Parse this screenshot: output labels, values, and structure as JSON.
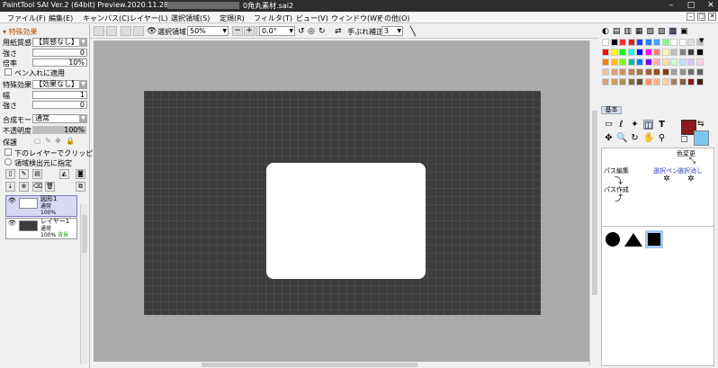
{
  "window": {
    "title": "PaintTool SAI Ver.2 (64bit) Preview.2020.11.28",
    "filename": "0角丸素材.sai2",
    "controls": [
      "–",
      "□",
      "✕"
    ]
  },
  "menu": [
    "ファイル(F)",
    "編集(E)",
    "キャンバス(C)",
    "レイヤー(L)",
    "選択領域(S)",
    "定規(R)",
    "フィルタ(T)",
    "ビュー(V)",
    "ウィンドウ(W)",
    "その他(O)"
  ],
  "toolbar": {
    "selection_label": "選択領域",
    "zoom_value": "50%",
    "zoom_minus": "−",
    "zoom_plus": "+",
    "angle_value": "0.0°",
    "stabilizer_label": "手ぶれ補正",
    "stabilizer_value": "3"
  },
  "left_panel": {
    "section_title": "特殊効果",
    "paper_texture_label": "用紙質感",
    "paper_texture_value": "【質感なし】",
    "strength_label": "強さ",
    "strength_value": "0",
    "scale_label": "倍率",
    "scale_value": "10%",
    "pen_apply_label": "ペン入れに適用",
    "special_effect_label": "特殊効果",
    "special_effect_value": "【効果なし】",
    "width_label": "幅",
    "width_value": "1",
    "strength2_label": "強さ",
    "strength2_value": "0",
    "blend_mode_label": "合成モード",
    "blend_mode_value": "通常",
    "opacity_label": "不透明度",
    "opacity_value": "100%",
    "protect_label": "保護",
    "clip_label": "下のレイヤーでクリッピング",
    "region_label": "領域検出元に指定"
  },
  "layers": [
    {
      "name": "図形1",
      "mode": "通常",
      "opacity": "100%",
      "extra": "",
      "selected": true
    },
    {
      "name": "レイヤー1",
      "mode": "通常",
      "opacity": "100%",
      "extra": "背景",
      "selected": false
    }
  ],
  "right_panel": {
    "tab_basic": "基本",
    "color_change_label": "色変更",
    "path_edit_label": "パス編集",
    "select_pen_label": "選択ペン",
    "select_erase_label": "選択消し",
    "path_create_label": "パス作成",
    "main_color": "#8b1a1a",
    "sub_color": "#7ec8f0"
  },
  "palette_colors": [
    "#ffffff",
    "#000000",
    "#ff3030",
    "#e02020",
    "#2040ff",
    "#2080ff",
    "#40a0ff",
    "#80ff80",
    "#ffffff",
    "#ffffff",
    "#e0e0e0",
    "#c0c0c0",
    "#ff0000",
    "#ffff00",
    "#00ff00",
    "#00ffff",
    "#0000ff",
    "#ff00ff",
    "#ff8080",
    "#ffffa0",
    "#c0c0c0",
    "#808080",
    "#404040",
    "#000000",
    "#ff8000",
    "#ffc000",
    "#80ff00",
    "#00c0a0",
    "#0080ff",
    "#8000ff",
    "#ffb0b0",
    "#ffe0a0",
    "#d0ffd0",
    "#c0e0ff",
    "#e0c0ff",
    "#ffd0e0",
    "#f0c0a0",
    "#e0a080",
    "#d09060",
    "#c08050",
    "#b07040",
    "#a06030",
    "#905020",
    "#804010",
    "#a0a0a0",
    "#909090",
    "#707070",
    "#606060",
    "#e0a070",
    "#c8a060",
    "#b09050",
    "#807040",
    "#605030",
    "#ff9060",
    "#ffb080",
    "#ffd0a0",
    "#a08060",
    "#806040",
    "#8b1a1a",
    "#402010"
  ],
  "shapes": [
    "circle",
    "triangle",
    "square"
  ]
}
